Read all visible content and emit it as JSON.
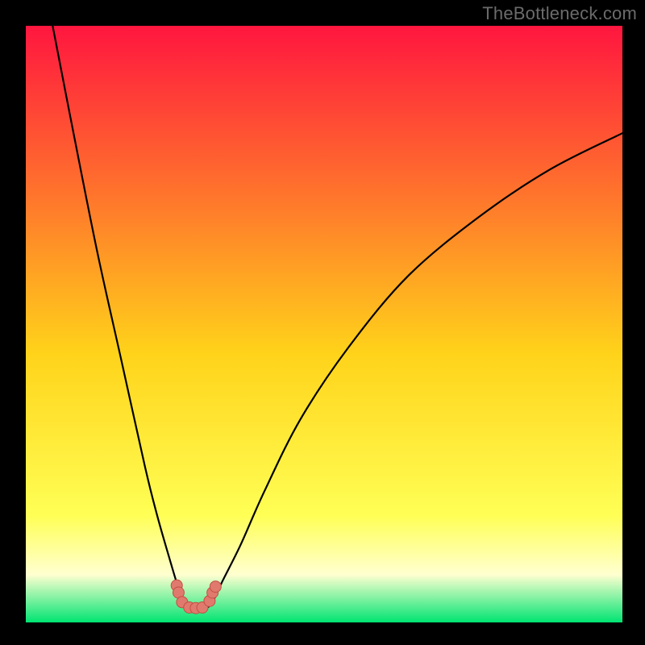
{
  "watermark": "TheBottleneck.com",
  "chart_data": {
    "type": "line",
    "title": "",
    "xlabel": "",
    "ylabel": "",
    "xlim": [
      0,
      100
    ],
    "ylim": [
      0,
      100
    ],
    "grid": false,
    "gradient_colors": {
      "top": "#ff163f",
      "upper_mid": "#ff7a2b",
      "mid": "#ffd31a",
      "lower_mid": "#ffff55",
      "haze": "#ffffd0",
      "bottom": "#00e472"
    },
    "series": [
      {
        "name": "curve-left",
        "x": [
          4.5,
          8,
          12,
          16,
          20,
          22,
          24,
          25.5,
          26.3,
          27.0
        ],
        "y": [
          100,
          82,
          62,
          44,
          26,
          18,
          11,
          6,
          4,
          2.6
        ]
      },
      {
        "name": "curve-right",
        "x": [
          30.6,
          31.6,
          33,
          36,
          40,
          46,
          54,
          64,
          76,
          88,
          100
        ],
        "y": [
          2.6,
          4,
          7,
          13,
          22,
          34,
          46,
          58,
          68,
          76,
          82
        ]
      },
      {
        "name": "curve-floor",
        "x": [
          27.0,
          28.5,
          30.6
        ],
        "y": [
          2.6,
          2.4,
          2.6
        ]
      }
    ],
    "markers": {
      "fill": "#e07a6e",
      "stroke": "#c44f43",
      "points": [
        {
          "group": "left-cluster",
          "x": 25.3,
          "y": 6.2
        },
        {
          "group": "left-cluster",
          "x": 25.6,
          "y": 5.0
        },
        {
          "group": "left-cluster",
          "x": 26.2,
          "y": 3.4
        },
        {
          "group": "floor-cluster",
          "x": 27.4,
          "y": 2.5
        },
        {
          "group": "floor-cluster",
          "x": 28.5,
          "y": 2.4
        },
        {
          "group": "floor-cluster",
          "x": 29.6,
          "y": 2.5
        },
        {
          "group": "right-cluster",
          "x": 30.8,
          "y": 3.6
        },
        {
          "group": "right-cluster",
          "x": 31.3,
          "y": 5.0
        },
        {
          "group": "right-cluster",
          "x": 31.8,
          "y": 6.0
        }
      ]
    }
  }
}
